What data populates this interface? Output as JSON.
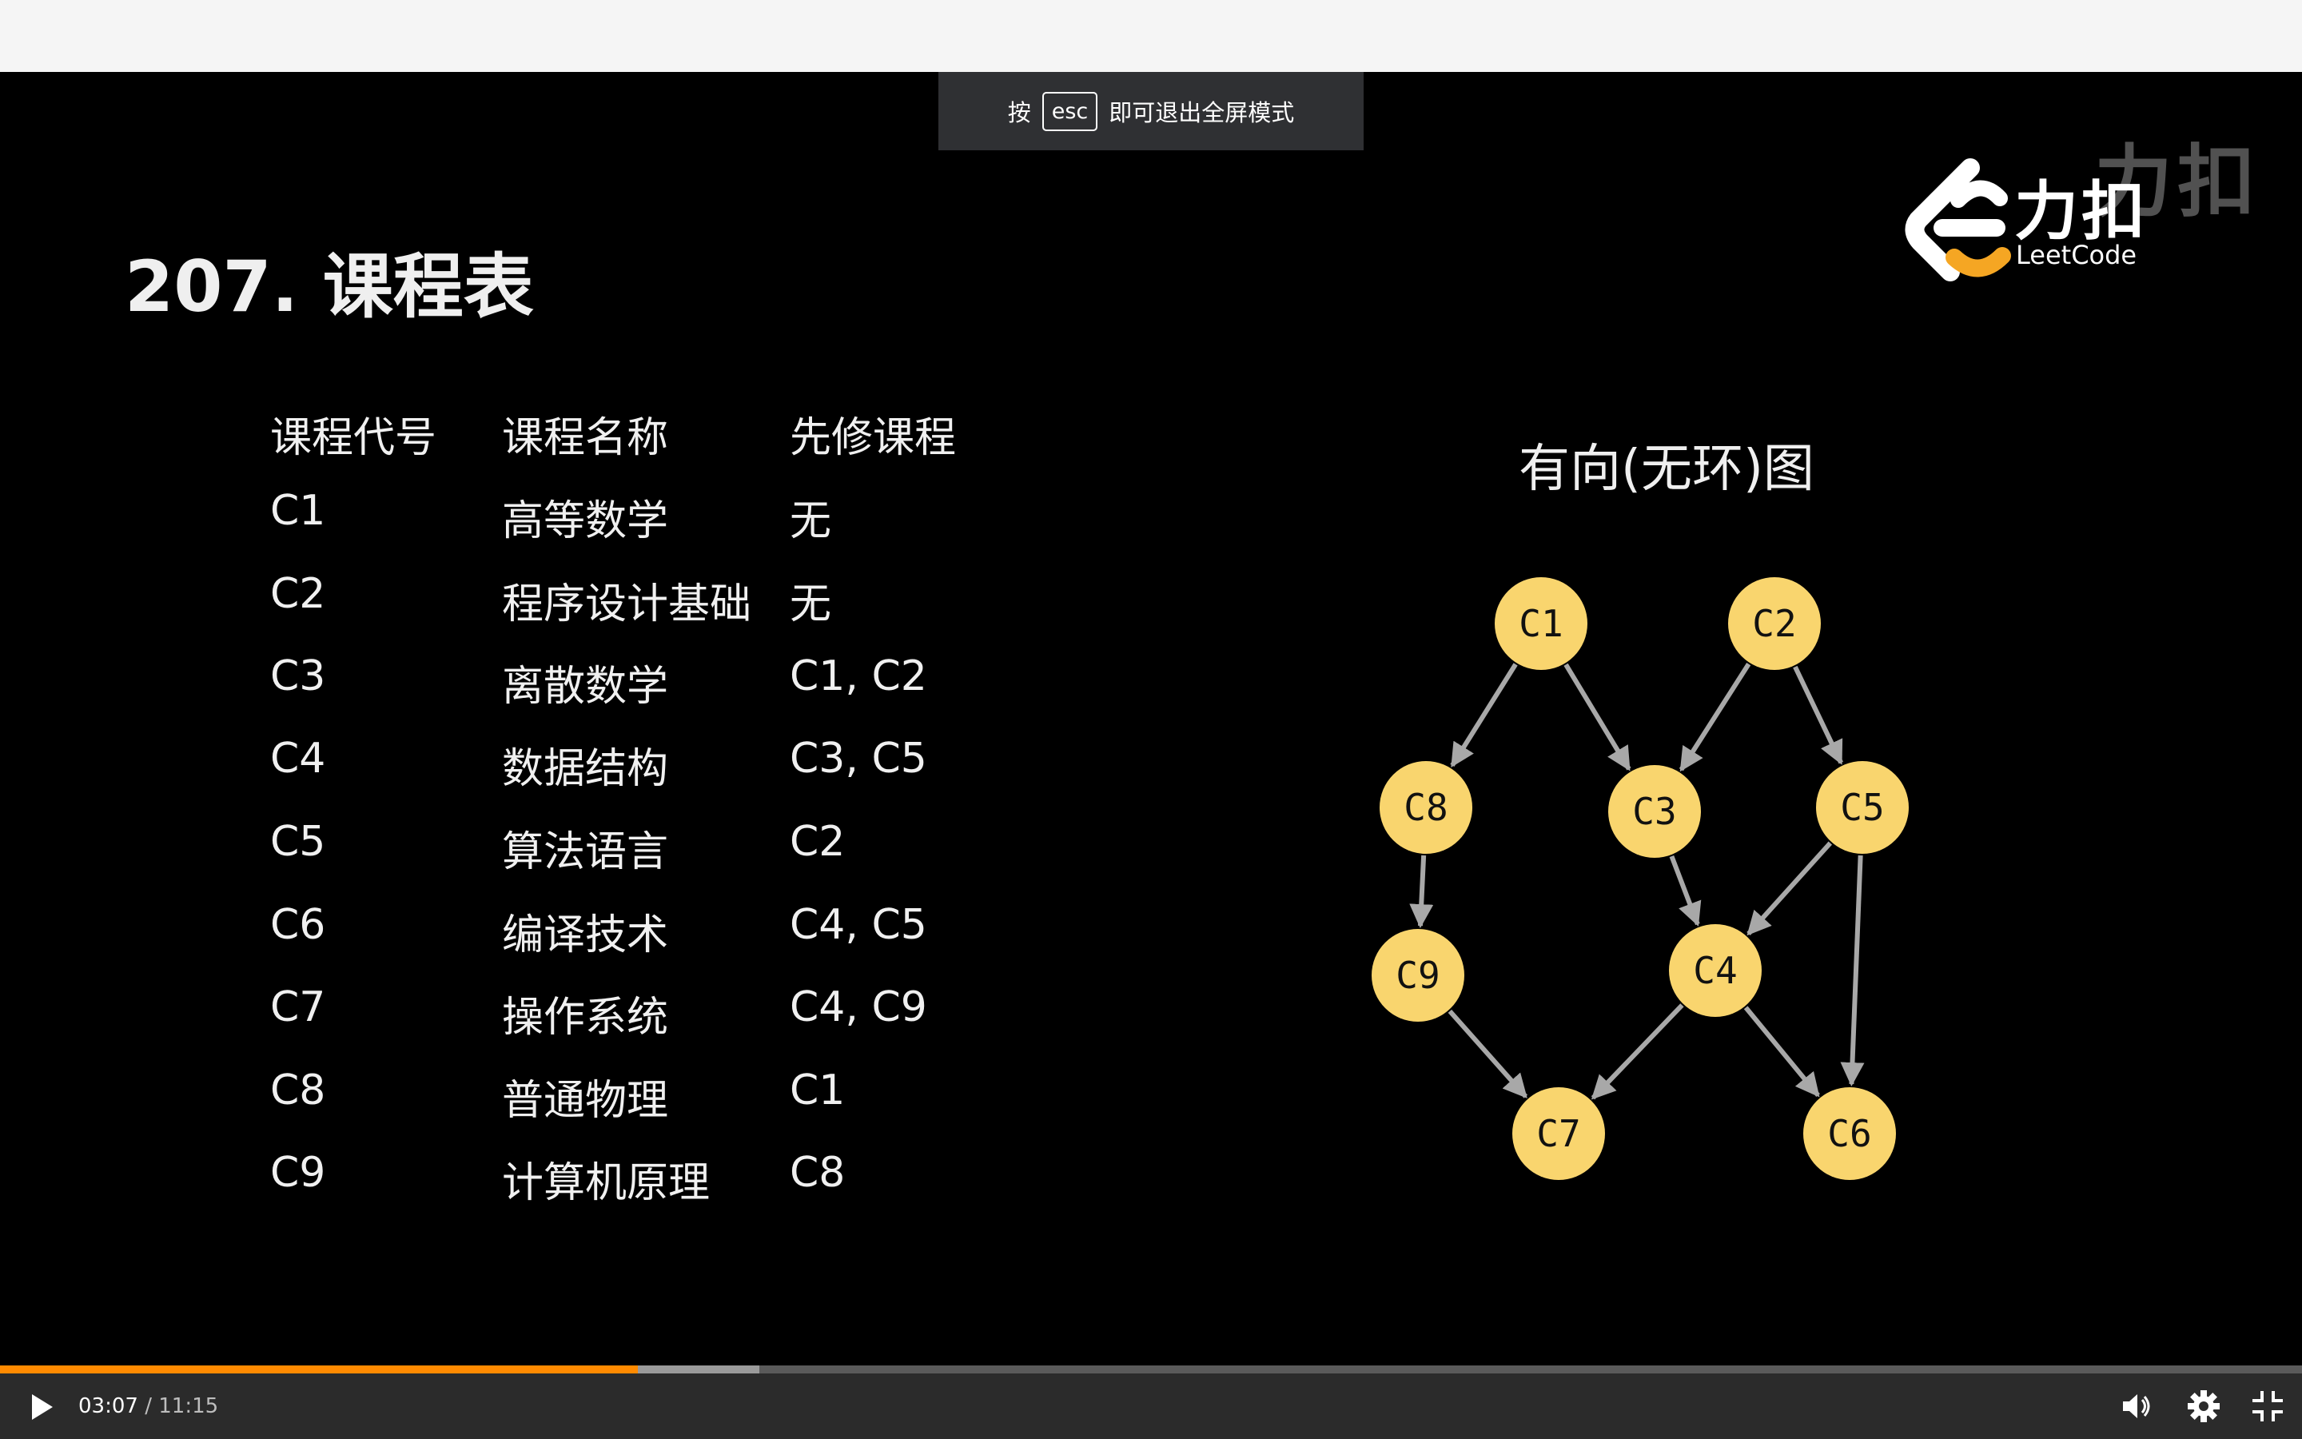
{
  "fullscreen_notice": {
    "prefix": "按",
    "key": "esc",
    "suffix": "即可退出全屏模式"
  },
  "slide": {
    "title": "207. 课程表",
    "table": {
      "headers": [
        "课程代号",
        "课程名称",
        "先修课程"
      ],
      "rows": [
        [
          "C1",
          "高等数学",
          "无"
        ],
        [
          "C2",
          "程序设计基础",
          "无"
        ],
        [
          "C3",
          "离散数学",
          "C1, C2"
        ],
        [
          "C4",
          "数据结构",
          "C3, C5"
        ],
        [
          "C5",
          "算法语言",
          "C2"
        ],
        [
          "C6",
          "编译技术",
          "C4, C5"
        ],
        [
          "C7",
          "操作系统",
          "C4, C9"
        ],
        [
          "C8",
          "普通物理",
          "C1"
        ],
        [
          "C9",
          "计算机原理",
          "C8"
        ]
      ]
    },
    "graph": {
      "title": "有向(无环)图",
      "nodes": [
        "C1",
        "C2",
        "C8",
        "C3",
        "C5",
        "C9",
        "C4",
        "C7",
        "C6"
      ],
      "edges": [
        [
          "C1",
          "C8"
        ],
        [
          "C1",
          "C3"
        ],
        [
          "C2",
          "C3"
        ],
        [
          "C2",
          "C5"
        ],
        [
          "C8",
          "C9"
        ],
        [
          "C3",
          "C4"
        ],
        [
          "C5",
          "C4"
        ],
        [
          "C5",
          "C6"
        ],
        [
          "C9",
          "C7"
        ],
        [
          "C4",
          "C7"
        ],
        [
          "C4",
          "C6"
        ]
      ],
      "node_color": "#f9d56e",
      "edge_color": "#a8a8a8"
    }
  },
  "logo": {
    "name_cn": "力扣",
    "name_en": "LeetCode",
    "ghost_text": "力扣",
    "accent": "#f5a623"
  },
  "player": {
    "current_time": "03:07",
    "separator": " / ",
    "total_time": "11:15",
    "progress_fraction": 0.277,
    "buffered_fraction": 0.33,
    "progress_color": "#ff8a00",
    "icons": [
      "play-icon",
      "volume-icon",
      "settings-icon",
      "exit-fullscreen-icon"
    ]
  }
}
